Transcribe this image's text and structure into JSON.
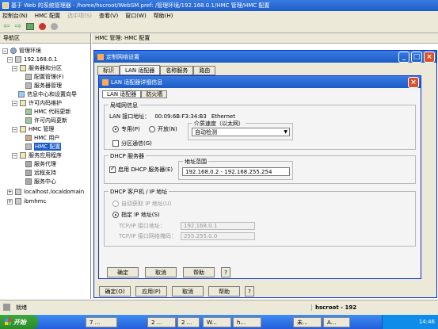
{
  "window": {
    "title": "基于 Web 的系统管理器 - /home/hscroot/WebSM.pref: /管理环境/192.168.0.1/HMC 管理/HMC 配置"
  },
  "menu": [
    "控制台(N)",
    "HMC 配置",
    "选中项(S)",
    "查看(V)",
    "窗口(W)",
    "帮助(H)"
  ],
  "nav": {
    "title": "导航区"
  },
  "tree": {
    "root": "管理环境",
    "host": "192.168.0.1",
    "servers_and_partitions": "服务器和分区",
    "partition_manager": "配置管理(F)",
    "server_management": "服务器管理",
    "info_center": "信息中心和设置向导",
    "license_maintenance": "许可内码维护",
    "hmc_code_update": "HMC 代码更新",
    "license_code_update": "许可内码更新",
    "hmc_management": "HMC 管理",
    "hmc_users": "HMC 用户",
    "hmc_config": "HMC 配置",
    "service_apps": "服务应用程序",
    "service_agent": "服务代理",
    "remote_support": "远程支持",
    "service_focal": "服务中心",
    "localhost": "localhost.localdomain",
    "ibmhmc": "ibmhmc"
  },
  "content": {
    "header": "HMC 管理: HMC 配置"
  },
  "outer_dialog": {
    "title": "定制网络设置",
    "tabs": [
      "标识",
      "LAN 适配器",
      "名称服务",
      "路由"
    ],
    "buttons": {
      "ok": "确定(O)",
      "apply": "应用(P)",
      "cancel": "取消",
      "help": "帮助",
      "question": "?"
    }
  },
  "inner_dialog": {
    "title": "LAN 适配器详细信息",
    "tabs": [
      "LAN 适配器",
      "防火墙"
    ],
    "lan_info": {
      "legend": "局域网信息",
      "interface_address": "LAN 接口地址：",
      "mac": "00:09:6B:F3:34:B3",
      "type": "Ethernet",
      "private_label": "专用(P)",
      "open_label": "开放(N)",
      "media_speed_legend": "介质速度（以太网）",
      "media_speed_value": "自动检测",
      "partition_comm": "分区通信(G)"
    },
    "dhcp_server": {
      "legend": "DHCP 服务器",
      "enable_label": "启用 DHCP 服务器(E)",
      "range_legend": "地址范围",
      "range_value": "192.168.0.2 - 192.168.255.254"
    },
    "dhcp_client": {
      "legend": "DHCP 客户机 / IP 地址",
      "auto_label": "自动获取 IP 地址(U)",
      "static_label": "指定 IP 地址(S)",
      "ip_label": "TCP/IP 接口地址：",
      "ip_value": "192.168.0.1",
      "mask_label": "TCP/IP 接口网络掩码：",
      "mask_value": "255.255.0.0"
    },
    "buttons": {
      "ok": "确定",
      "cancel": "取消",
      "help": "帮助",
      "question": "?"
    }
  },
  "status": {
    "left": "就绪",
    "right": "hscroot - 192"
  },
  "taskbar": {
    "start": "开始",
    "items": [
      "7 ...",
      "2 ...",
      "2 ...",
      "W...",
      "h...",
      "未...",
      "A..."
    ],
    "tray_time": "14:46"
  }
}
